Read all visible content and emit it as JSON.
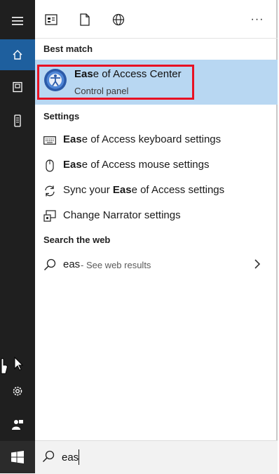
{
  "rail": {
    "items": [
      "hamburger-menu",
      "home",
      "documents",
      "devices",
      "settings",
      "user",
      "start"
    ]
  },
  "toolbar": {
    "icons": [
      "apps-icon",
      "documents-icon",
      "web-icon",
      "more-icon"
    ],
    "more_label": "···"
  },
  "best_match": {
    "header": "Best match",
    "title_bold": "Eas",
    "title_rest": "e of Access Center",
    "subtitle": "Control panel",
    "highlight_color": "#b8d7f2",
    "outline_color": "#e81123"
  },
  "settings": {
    "header": "Settings",
    "items": [
      {
        "icon": "keyboard-icon",
        "bold": "Eas",
        "rest": "e of Access keyboard settings",
        "prefix": ""
      },
      {
        "icon": "mouse-icon",
        "bold": "Eas",
        "rest": "e of Access mouse settings",
        "prefix": ""
      },
      {
        "icon": "sync-icon",
        "prefix": "Sync your ",
        "bold": "Eas",
        "rest": "e of Access settings"
      },
      {
        "icon": "narrator-icon",
        "prefix": "Change Narrator settings",
        "bold": "",
        "rest": ""
      }
    ]
  },
  "web": {
    "header": "Search the web",
    "term": "eas",
    "hint": "- See web results"
  },
  "search": {
    "value": "eas"
  },
  "colors": {
    "rail_bg": "#1f1f1f",
    "rail_active": "#1e5f9e",
    "accent": "#1e5f9e"
  }
}
